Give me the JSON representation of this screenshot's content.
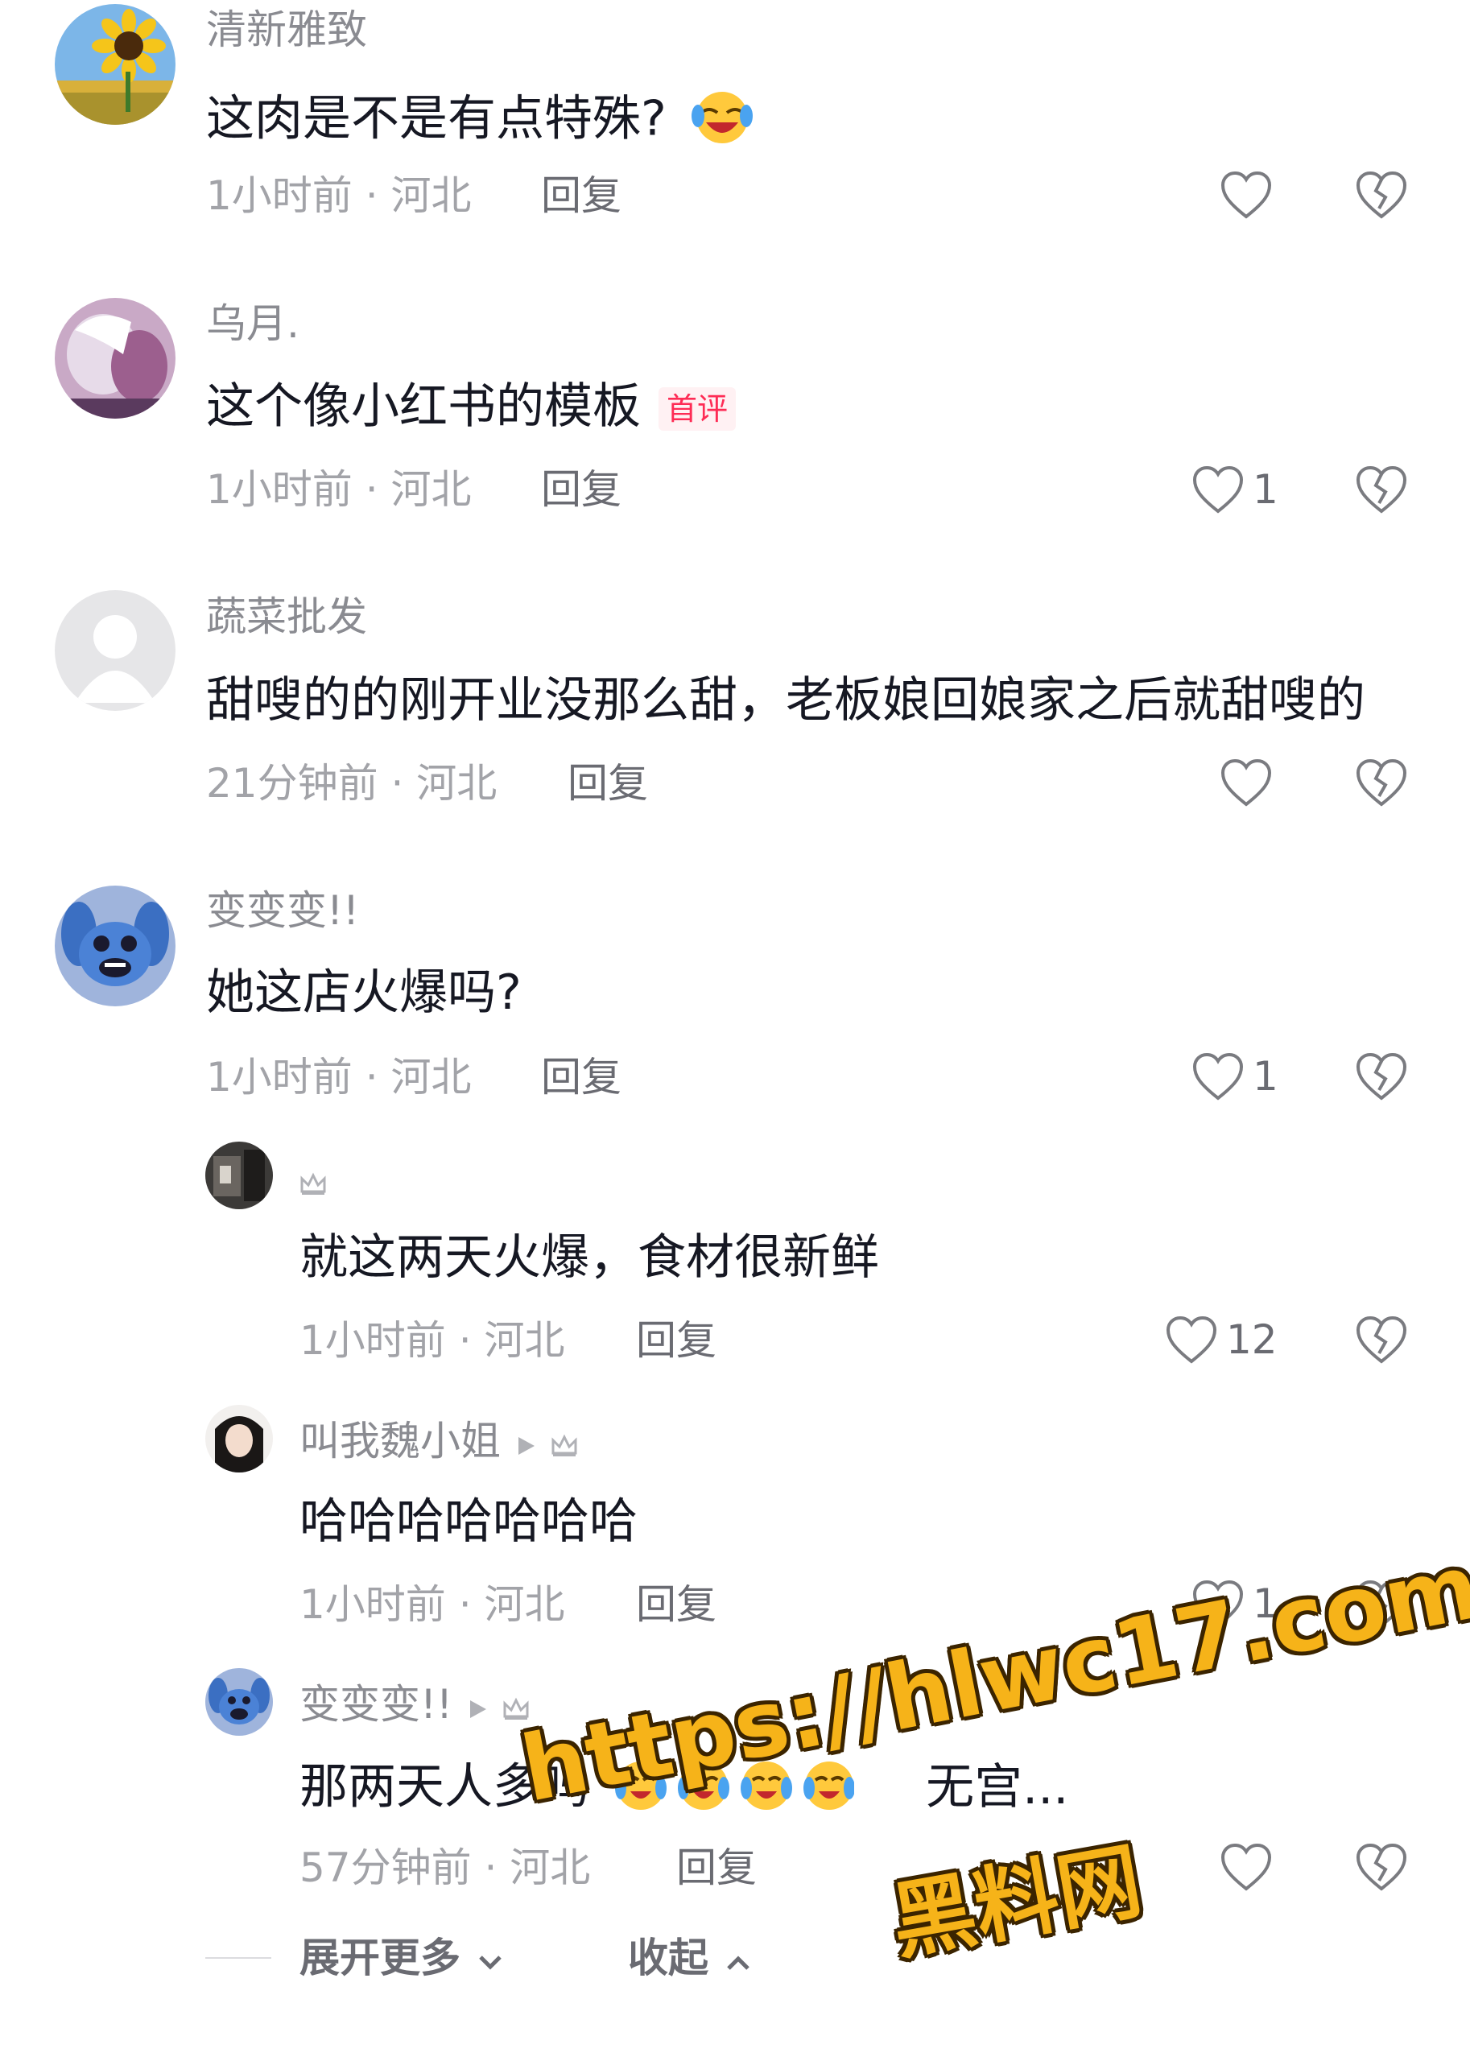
{
  "colors": {
    "text_primary": "#161823",
    "username": "#8a8b91",
    "meta": "#a2a3a8",
    "reply": "#6a6b72",
    "first_comment_badge": "#fe2c55",
    "watermark": "#f6b319"
  },
  "comments": [
    {
      "username": "清新雅致",
      "avatar": "sunflower-avatar",
      "text": "这肉是不是有点特殊?",
      "emoji": "laughing-crying-emoji",
      "meta": "1小时前 · 河北",
      "reply_label": "回复",
      "likes": ""
    },
    {
      "username": "乌月.",
      "avatar": "anime-couple-avatar",
      "text": "这个像小红书的模板",
      "badge": "首评",
      "meta": "1小时前 · 河北",
      "reply_label": "回复",
      "likes": "1"
    },
    {
      "username": "蔬菜批发",
      "avatar": "default-user-avatar",
      "text": "甜嗖的的刚开业没那么甜，老板娘回娘家之后就甜嗖的",
      "meta": "21分钟前 · 河北",
      "reply_label": "回复",
      "likes": ""
    },
    {
      "username": "变变变!!",
      "avatar": "stitch-avatar",
      "text": "她这店火爆吗?",
      "meta": "1小时前 · 河北",
      "reply_label": "回复",
      "likes": "1"
    }
  ],
  "replies": [
    {
      "username": "",
      "avatar": "dark-photo-avatar",
      "crown_icon": "crown-icon",
      "text": "就这两天火爆，食材很新鲜",
      "meta": "1小时前 · 河北",
      "reply_label": "回复",
      "likes": "12"
    },
    {
      "username": "叫我魏小姐",
      "avatar": "girl-photo-avatar",
      "crown_icon": "crown-icon",
      "text": "哈哈哈哈哈哈哈",
      "meta": "1小时前 · 河北",
      "reply_label": "回复",
      "likes": "1"
    },
    {
      "username": "变变变!!",
      "avatar": "stitch-avatar",
      "crown_icon": "crown-icon",
      "text": "那两天人多吗",
      "emoji": "crying-emoji",
      "trailing_text": "无宫...",
      "meta": "57分钟前 · 河北",
      "reply_label": "回复",
      "likes": ""
    }
  ],
  "footer": {
    "expand_more": "展开更多",
    "collapse": "收起"
  },
  "watermark": {
    "url": "https://hlwc17.com",
    "name": "黑料网"
  }
}
